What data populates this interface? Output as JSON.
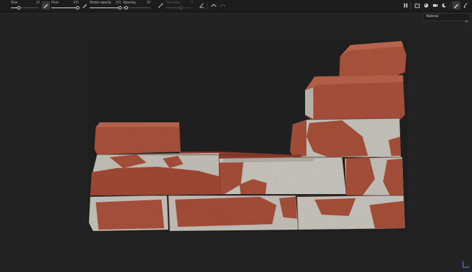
{
  "toolbar": {
    "sliders": [
      {
        "label": "Size",
        "value": "10",
        "level": 0.28
      },
      {
        "label": "Flow",
        "value": "100",
        "level": 1.0
      },
      {
        "label": "Stroke opacity",
        "value": "100",
        "level": 1.0
      },
      {
        "label": "Spacing",
        "value": "20",
        "level": 0.1
      },
      {
        "label": "Tolerance",
        "value": "0",
        "level": 0.55
      }
    ],
    "icons": [
      "brush-pressure-icon",
      "brush-pressure-icon-2",
      "symmetry-icon",
      "angle-icon",
      "dot-grid-icon",
      "lazy-mouse-icon",
      "pause-icon",
      "folder-icon",
      "sphere-icon",
      "camera-icon",
      "environment-icon",
      "paint-brush-icon",
      "settings-icon"
    ]
  },
  "channel_select": {
    "value": "Material"
  },
  "colors": {
    "background": "#232323",
    "toolbar": "#1c1c1c",
    "brick": "#b5563f",
    "mortar": "#d8d5cd"
  }
}
